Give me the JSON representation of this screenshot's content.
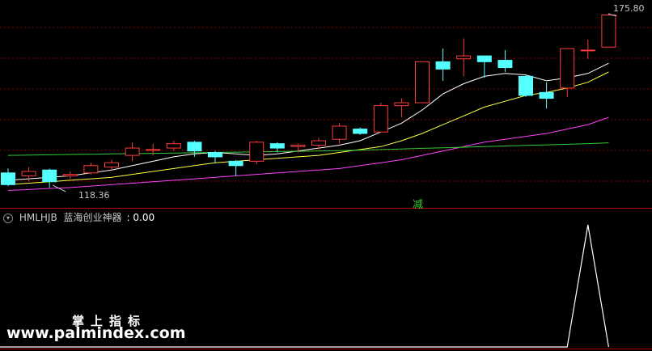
{
  "price_panel": {
    "high_label": "175.80",
    "low_label": "118.36",
    "signal_text": "减"
  },
  "indicator": {
    "code": "HMLHJB",
    "name": "蓝海创业神器",
    "value": "0.00",
    "collapse_icon": "chevron-down-icon"
  },
  "watermark": {
    "cn": "掌上指标",
    "url": "www.palmindex.com"
  },
  "colors": {
    "up": "#ff3c3c",
    "down": "#54ffff",
    "ma5": "#ffffff",
    "ma10": "#ffff40",
    "ma20": "#ff40ff",
    "ma60": "#33cc33",
    "grid": "#8b0000",
    "signal": "#ffffff"
  },
  "chart_data": {
    "type": "candlestick",
    "ylim": [
      112,
      180
    ],
    "candles": [
      {
        "o": 122.0,
        "c": 118.0,
        "h": 123.5,
        "l": 117.5
      },
      {
        "o": 121.0,
        "c": 122.5,
        "h": 124.0,
        "l": 119.0
      },
      {
        "o": 123.0,
        "c": 119.0,
        "h": 123.5,
        "l": 117.0
      },
      {
        "o": 121.0,
        "c": 121.5,
        "h": 122.5,
        "l": 120.0
      },
      {
        "o": 122.0,
        "c": 124.5,
        "h": 125.5,
        "l": 121.5
      },
      {
        "o": 124.0,
        "c": 125.5,
        "h": 126.5,
        "l": 123.0
      },
      {
        "o": 128.0,
        "c": 130.5,
        "h": 132.5,
        "l": 126.0
      },
      {
        "o": 130.0,
        "c": 130.0,
        "h": 132.0,
        "l": 128.0
      },
      {
        "o": 130.5,
        "c": 132.0,
        "h": 133.0,
        "l": 129.5
      },
      {
        "o": 132.5,
        "c": 129.5,
        "h": 133.0,
        "l": 127.5
      },
      {
        "o": 129.0,
        "c": 127.5,
        "h": 129.5,
        "l": 125.5
      },
      {
        "o": 126.0,
        "c": 124.5,
        "h": 126.5,
        "l": 121.0
      },
      {
        "o": 126.0,
        "c": 132.5,
        "h": 133.0,
        "l": 125.0
      },
      {
        "o": 132.0,
        "c": 130.5,
        "h": 132.5,
        "l": 129.0
      },
      {
        "o": 131.0,
        "c": 131.5,
        "h": 132.0,
        "l": 129.0
      },
      {
        "o": 131.5,
        "c": 133.0,
        "h": 134.0,
        "l": 130.0
      },
      {
        "o": 133.5,
        "c": 138.0,
        "h": 139.0,
        "l": 132.0
      },
      {
        "o": 137.0,
        "c": 135.5,
        "h": 137.5,
        "l": 135.0
      },
      {
        "o": 136.0,
        "c": 145.0,
        "h": 146.0,
        "l": 136.0
      },
      {
        "o": 145.0,
        "c": 146.0,
        "h": 147.5,
        "l": 141.0
      },
      {
        "o": 146.0,
        "c": 160.0,
        "h": 160.0,
        "l": 146.0
      },
      {
        "o": 160.0,
        "c": 157.5,
        "h": 164.5,
        "l": 153.5
      },
      {
        "o": 161.0,
        "c": 162.0,
        "h": 168.0,
        "l": 155.0
      },
      {
        "o": 162.0,
        "c": 160.0,
        "h": 162.0,
        "l": 154.5
      },
      {
        "o": 160.5,
        "c": 158.0,
        "h": 164.0,
        "l": 156.5
      },
      {
        "o": 155.0,
        "c": 148.5,
        "h": 155.5,
        "l": 148.0
      },
      {
        "o": 149.5,
        "c": 147.5,
        "h": 153.0,
        "l": 144.0
      },
      {
        "o": 151.0,
        "c": 164.5,
        "h": 164.5,
        "l": 148.0
      },
      {
        "o": 164.0,
        "c": 164.0,
        "h": 167.5,
        "l": 161.0
      },
      {
        "o": 165.0,
        "c": 176.0,
        "h": 176.5,
        "l": 165.0
      }
    ],
    "ma": [
      {
        "name": "ma5",
        "color": "#ffffff",
        "values": [
          119.5,
          120,
          120.5,
          121,
          122,
          123,
          124.5,
          126,
          127.5,
          128.5,
          129,
          128.5,
          128,
          128.5,
          129.5,
          130.5,
          131.5,
          133,
          136,
          139,
          143.5,
          149,
          152.5,
          155,
          156,
          155.5,
          153.5,
          154.5,
          156,
          159.5
        ]
      },
      {
        "name": "ma10",
        "color": "#ffff40",
        "values": [
          118,
          118.5,
          119,
          119.5,
          120,
          120.5,
          121.5,
          122.5,
          123.5,
          124.5,
          125.5,
          126,
          126.5,
          127,
          127.5,
          128,
          129,
          130,
          131,
          133,
          135.5,
          138.5,
          141.5,
          144.5,
          146.5,
          148.5,
          149.5,
          151,
          153,
          156.5
        ]
      },
      {
        "name": "ma20",
        "color": "#ff40ff",
        "values": [
          116,
          116.3,
          116.7,
          117,
          117.5,
          118,
          118.5,
          119,
          119.5,
          120,
          120.5,
          121,
          121.5,
          122,
          122.5,
          123,
          123.5,
          124.5,
          125.5,
          126.5,
          128,
          129.5,
          131,
          132.5,
          133.5,
          134.5,
          135.5,
          137,
          138.5,
          141
        ]
      },
      {
        "name": "ma60",
        "color": "#33cc33",
        "values": [
          128,
          128.1,
          128.2,
          128.3,
          128.4,
          128.5,
          128.6,
          128.7,
          128.8,
          128.9,
          129,
          129.1,
          129.2,
          129.3,
          129.4,
          129.5,
          129.6,
          129.8,
          130,
          130.2,
          130.4,
          130.6,
          130.8,
          131,
          131.2,
          131.4,
          131.6,
          131.8,
          132,
          132.3
        ]
      }
    ],
    "indicator_series": {
      "name": "蓝海创业神器",
      "ylim": [
        0,
        1
      ],
      "values": [
        0,
        0,
        0,
        0,
        0,
        0,
        0,
        0,
        0,
        0,
        0,
        0,
        0,
        0,
        0,
        0,
        0,
        0,
        0,
        0,
        0,
        0,
        0,
        0,
        0,
        0,
        0,
        0,
        1,
        0
      ]
    }
  }
}
